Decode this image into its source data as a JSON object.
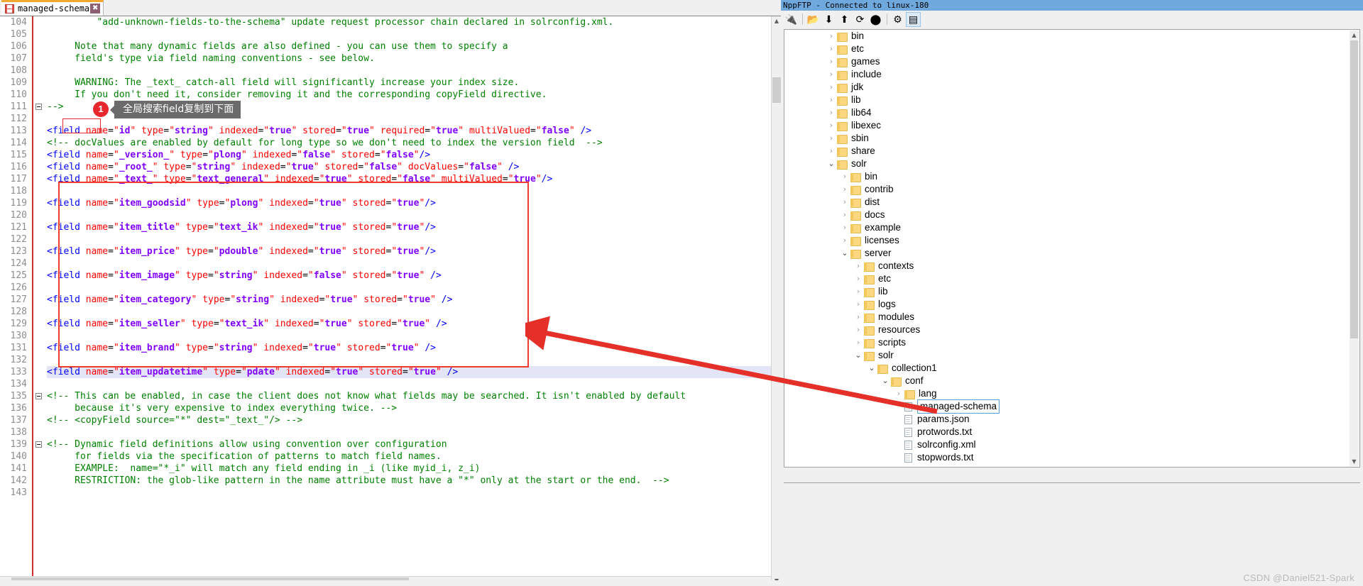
{
  "editor": {
    "tab": {
      "label": "managed-schema",
      "close_glyph": "✖",
      "icon": "floppy-disk-icon"
    },
    "first_line_number": 104,
    "lines": [
      {
        "n": 104,
        "indent": 9,
        "type": "comment",
        "text": "\"add-unknown-fields-to-the-schema\" update request processor chain declared in solrconfig.xml."
      },
      {
        "n": 105,
        "indent": 0,
        "type": "blank",
        "text": ""
      },
      {
        "n": 106,
        "indent": 5,
        "type": "comment",
        "text": "Note that many dynamic fields are also defined - you can use them to specify a"
      },
      {
        "n": 107,
        "indent": 5,
        "type": "comment",
        "text": "field's type via field naming conventions - see below."
      },
      {
        "n": 108,
        "indent": 0,
        "type": "blank",
        "text": ""
      },
      {
        "n": 109,
        "indent": 5,
        "type": "comment",
        "text": "WARNING: The _text_ catch-all field will significantly increase your index size."
      },
      {
        "n": 110,
        "indent": 5,
        "type": "comment",
        "text": "If you don't need it, consider removing it and the corresponding copyField directive."
      },
      {
        "n": 111,
        "indent": 0,
        "type": "comment",
        "text": "-->"
      },
      {
        "n": 112,
        "indent": 0,
        "type": "blank",
        "text": ""
      },
      {
        "n": 113,
        "indent": 0,
        "type": "field",
        "text": "<field name=\"id\" type=\"string\" indexed=\"true\" stored=\"true\" required=\"true\" multiValued=\"false\" />"
      },
      {
        "n": 114,
        "indent": 0,
        "type": "comment",
        "text": "<!-- docValues are enabled by default for long type so we don't need to index the version field  -->"
      },
      {
        "n": 115,
        "indent": 0,
        "type": "field",
        "text": "<field name=\"_version_\" type=\"plong\" indexed=\"false\" stored=\"false\"/>"
      },
      {
        "n": 116,
        "indent": 0,
        "type": "field",
        "text": "<field name=\"_root_\" type=\"string\" indexed=\"true\" stored=\"false\" docValues=\"false\" />"
      },
      {
        "n": 117,
        "indent": 0,
        "type": "field",
        "text": "<field name=\"_text_\" type=\"text_general\" indexed=\"true\" stored=\"false\" multiValued=\"true\"/>"
      },
      {
        "n": 118,
        "indent": 0,
        "type": "blank",
        "text": ""
      },
      {
        "n": 119,
        "indent": 0,
        "type": "field",
        "text": "<field name=\"item_goodsid\" type=\"plong\" indexed=\"true\" stored=\"true\"/>"
      },
      {
        "n": 120,
        "indent": 0,
        "type": "blank",
        "text": ""
      },
      {
        "n": 121,
        "indent": 0,
        "type": "field",
        "text": "<field name=\"item_title\" type=\"text_ik\" indexed=\"true\" stored=\"true\"/>"
      },
      {
        "n": 122,
        "indent": 0,
        "type": "blank",
        "text": ""
      },
      {
        "n": 123,
        "indent": 0,
        "type": "field",
        "text": "<field name=\"item_price\" type=\"pdouble\" indexed=\"true\" stored=\"true\"/>"
      },
      {
        "n": 124,
        "indent": 0,
        "type": "blank",
        "text": ""
      },
      {
        "n": 125,
        "indent": 0,
        "type": "field",
        "text": "<field name=\"item_image\" type=\"string\" indexed=\"false\" stored=\"true\" />"
      },
      {
        "n": 126,
        "indent": 0,
        "type": "blank",
        "text": ""
      },
      {
        "n": 127,
        "indent": 0,
        "type": "field",
        "text": "<field name=\"item_category\" type=\"string\" indexed=\"true\" stored=\"true\" />"
      },
      {
        "n": 128,
        "indent": 0,
        "type": "blank",
        "text": ""
      },
      {
        "n": 129,
        "indent": 0,
        "type": "field",
        "text": "<field name=\"item_seller\" type=\"text_ik\" indexed=\"true\" stored=\"true\" />"
      },
      {
        "n": 130,
        "indent": 0,
        "type": "blank",
        "text": ""
      },
      {
        "n": 131,
        "indent": 0,
        "type": "field",
        "text": "<field name=\"item_brand\" type=\"string\" indexed=\"true\" stored=\"true\" />"
      },
      {
        "n": 132,
        "indent": 0,
        "type": "blank",
        "text": ""
      },
      {
        "n": 133,
        "indent": 0,
        "type": "field",
        "text": "<field name=\"item_updatetime\" type=\"pdate\" indexed=\"true\" stored=\"true\" />",
        "highlight": true
      },
      {
        "n": 134,
        "indent": 0,
        "type": "blank",
        "text": ""
      },
      {
        "n": 135,
        "indent": 0,
        "type": "comment",
        "text": "<!-- This can be enabled, in case the client does not know what fields may be searched. It isn't enabled by default"
      },
      {
        "n": 136,
        "indent": 5,
        "type": "comment",
        "text": "because it's very expensive to index everything twice. -->"
      },
      {
        "n": 137,
        "indent": 0,
        "type": "comment",
        "text": "<!-- <copyField source=\"*\" dest=\"_text_\"/> -->"
      },
      {
        "n": 138,
        "indent": 0,
        "type": "blank",
        "text": ""
      },
      {
        "n": 139,
        "indent": 0,
        "type": "comment",
        "text": "<!-- Dynamic field definitions allow using convention over configuration"
      },
      {
        "n": 140,
        "indent": 5,
        "type": "comment",
        "text": "for fields via the specification of patterns to match field names."
      },
      {
        "n": 141,
        "indent": 5,
        "type": "comment",
        "text": "EXAMPLE:  name=\"*_i\" will match any field ending in _i (like myid_i, z_i)"
      },
      {
        "n": 142,
        "indent": 5,
        "type": "comment",
        "text": "RESTRICTION: the glob-like pattern in the name attribute must have a \"*\" only at the start or the end.  -->"
      },
      {
        "n": 143,
        "indent": 0,
        "type": "blank",
        "text": ""
      }
    ],
    "fold_lines": [
      111,
      135,
      139
    ]
  },
  "annotations": {
    "step_badge": "1",
    "tooltip": "全局搜索field复制到下面",
    "box_color": "#f03c2e",
    "arrow_color": "#e5302a",
    "arrow_from": "managed-schema file in tree",
    "arrow_to": "field definitions block"
  },
  "ftp": {
    "title": "NppFTP - Connected to linux-180",
    "toolbar": [
      {
        "name": "connect-icon",
        "glyph": "🔌"
      },
      {
        "name": "open-folder-icon",
        "glyph": "📂"
      },
      {
        "name": "download-icon",
        "glyph": "⬇"
      },
      {
        "name": "upload-icon",
        "glyph": "⬆"
      },
      {
        "name": "refresh-icon",
        "glyph": "⟳"
      },
      {
        "name": "abort-icon",
        "glyph": "⬤"
      },
      {
        "name": "settings-icon",
        "glyph": "⚙"
      },
      {
        "name": "messages-icon",
        "glyph": "▤"
      }
    ],
    "tree": [
      {
        "label": "bin",
        "depth": 0,
        "kind": "folder",
        "state": "collapsed"
      },
      {
        "label": "etc",
        "depth": 0,
        "kind": "folder",
        "state": "collapsed"
      },
      {
        "label": "games",
        "depth": 0,
        "kind": "folder",
        "state": "collapsed"
      },
      {
        "label": "include",
        "depth": 0,
        "kind": "folder",
        "state": "collapsed"
      },
      {
        "label": "jdk",
        "depth": 0,
        "kind": "folder",
        "state": "collapsed"
      },
      {
        "label": "lib",
        "depth": 0,
        "kind": "folder",
        "state": "collapsed"
      },
      {
        "label": "lib64",
        "depth": 0,
        "kind": "folder",
        "state": "collapsed"
      },
      {
        "label": "libexec",
        "depth": 0,
        "kind": "folder",
        "state": "collapsed"
      },
      {
        "label": "sbin",
        "depth": 0,
        "kind": "folder",
        "state": "collapsed"
      },
      {
        "label": "share",
        "depth": 0,
        "kind": "folder",
        "state": "collapsed"
      },
      {
        "label": "solr",
        "depth": 0,
        "kind": "folder",
        "state": "expanded"
      },
      {
        "label": "bin",
        "depth": 1,
        "kind": "folder",
        "state": "collapsed"
      },
      {
        "label": "contrib",
        "depth": 1,
        "kind": "folder",
        "state": "collapsed"
      },
      {
        "label": "dist",
        "depth": 1,
        "kind": "folder",
        "state": "collapsed"
      },
      {
        "label": "docs",
        "depth": 1,
        "kind": "folder",
        "state": "collapsed"
      },
      {
        "label": "example",
        "depth": 1,
        "kind": "folder",
        "state": "collapsed"
      },
      {
        "label": "licenses",
        "depth": 1,
        "kind": "folder",
        "state": "collapsed"
      },
      {
        "label": "server",
        "depth": 1,
        "kind": "folder",
        "state": "expanded"
      },
      {
        "label": "contexts",
        "depth": 2,
        "kind": "folder",
        "state": "collapsed"
      },
      {
        "label": "etc",
        "depth": 2,
        "kind": "folder",
        "state": "collapsed"
      },
      {
        "label": "lib",
        "depth": 2,
        "kind": "folder",
        "state": "collapsed"
      },
      {
        "label": "logs",
        "depth": 2,
        "kind": "folder",
        "state": "collapsed"
      },
      {
        "label": "modules",
        "depth": 2,
        "kind": "folder",
        "state": "collapsed"
      },
      {
        "label": "resources",
        "depth": 2,
        "kind": "folder",
        "state": "collapsed"
      },
      {
        "label": "scripts",
        "depth": 2,
        "kind": "folder",
        "state": "collapsed"
      },
      {
        "label": "solr",
        "depth": 2,
        "kind": "folder",
        "state": "expanded"
      },
      {
        "label": "collection1",
        "depth": 3,
        "kind": "folder",
        "state": "expanded"
      },
      {
        "label": "conf",
        "depth": 4,
        "kind": "folder",
        "state": "expanded"
      },
      {
        "label": "lang",
        "depth": 5,
        "kind": "folder",
        "state": "collapsed"
      },
      {
        "label": "managed-schema",
        "depth": 5,
        "kind": "file",
        "state": "selected"
      },
      {
        "label": "params.json",
        "depth": 5,
        "kind": "file",
        "state": "none"
      },
      {
        "label": "protwords.txt",
        "depth": 5,
        "kind": "file",
        "state": "none"
      },
      {
        "label": "solrconfig.xml",
        "depth": 5,
        "kind": "file",
        "state": "none"
      },
      {
        "label": "stopwords.txt",
        "depth": 5,
        "kind": "file",
        "state": "none"
      }
    ]
  },
  "watermark": "CSDN @Daniel521-Spark"
}
